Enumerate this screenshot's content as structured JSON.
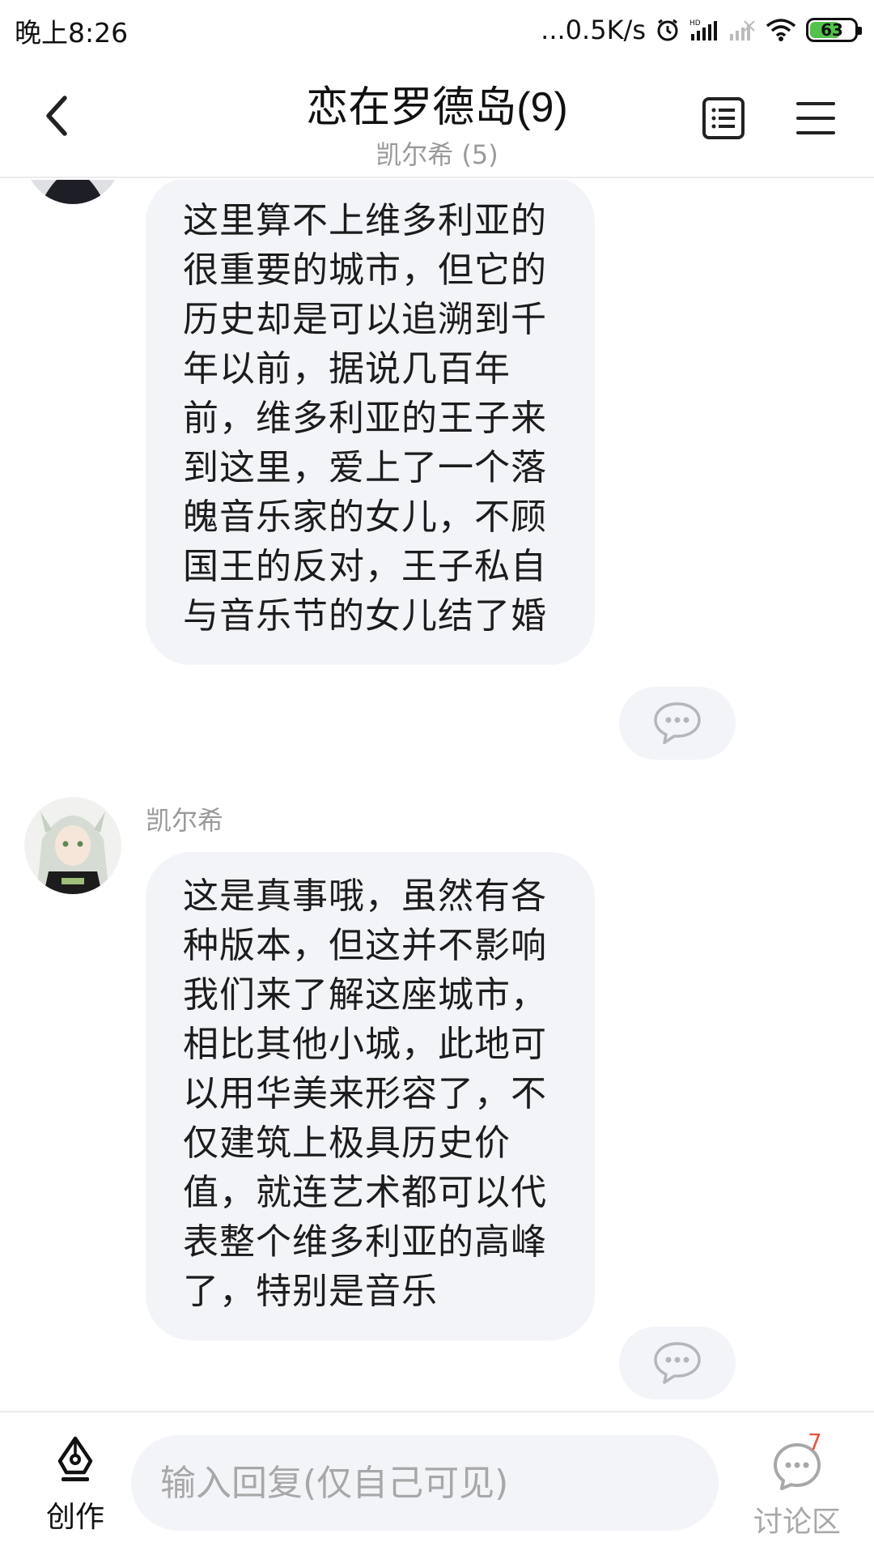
{
  "status_bar": {
    "time": "晚上8:26",
    "network_speed": "...0.5K/s",
    "battery_level": "63"
  },
  "header": {
    "title": "恋在罗德岛(9)",
    "subtitle": "凯尔希 (5)"
  },
  "messages": [
    {
      "sender": "",
      "text": "这里算不上维多利亚的很重要的城市，但它的历史却是可以追溯到千年以前，据说几百年前，维多利亚的王子来到这里，爱上了一个落魄音乐家的女儿，不顾国王的反对，王子私自与音乐节的女儿结了婚"
    },
    {
      "sender": "凯尔希",
      "text": "这是真事哦，虽然有各种版本，但这并不影响我们来了解这座城市，相比其他小城，此地可以用华美来形容了，不仅建筑上极具历史价值，就连艺术都可以代表整个维多利亚的高峰了，特别是音乐"
    }
  ],
  "bottom_bar": {
    "create_label": "创作",
    "reply_placeholder": "输入回复(仅自己可见)",
    "discuss_label": "讨论区",
    "discuss_count": "7"
  },
  "colors": {
    "bubble_bg": "#f3f4f8",
    "battery_fill": "#53c24a",
    "badge_red": "#e8553f",
    "muted_text": "#9a9a9a"
  },
  "icons": {
    "back": "chevron-left-icon",
    "catalog": "catalog-list-icon",
    "menu": "hamburger-menu-icon",
    "comment": "comment-bubble-icon",
    "create": "pen-nib-icon",
    "discuss": "discussion-icon"
  }
}
